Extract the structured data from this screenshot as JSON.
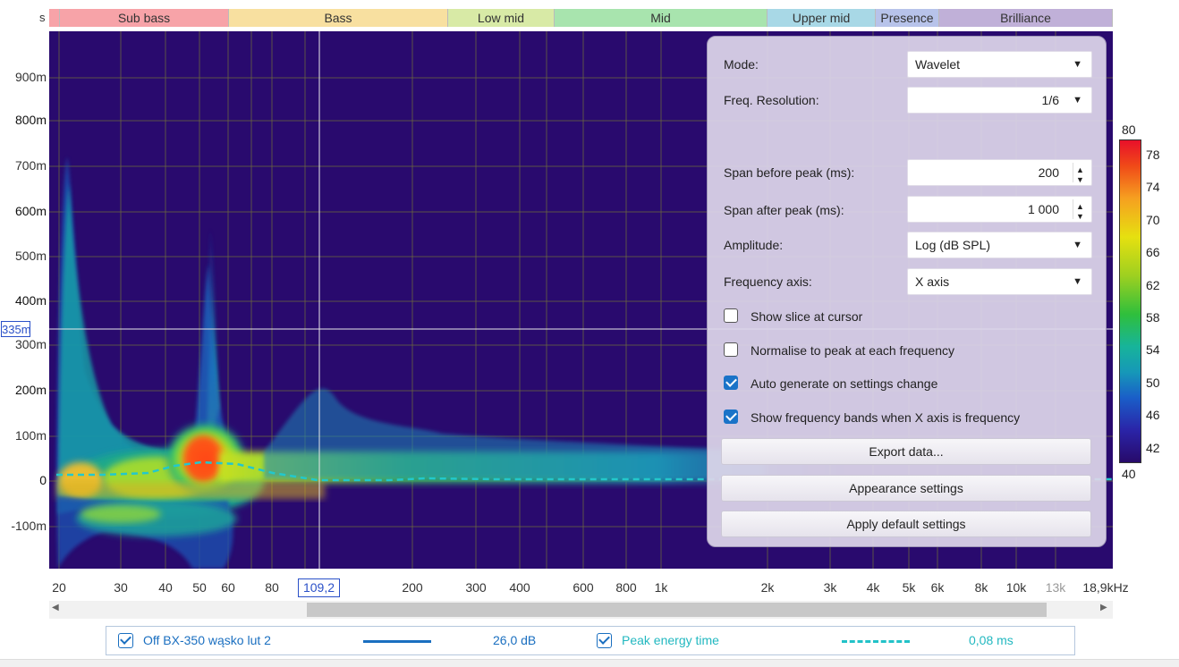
{
  "axis_unit_label": "s",
  "freq_bands": [
    {
      "label": "Sub bass",
      "color": "#f7a3a8"
    },
    {
      "label": "Bass",
      "color": "#f8e0a0"
    },
    {
      "label": "Low mid",
      "color": "#d8eaa6"
    },
    {
      "label": "Mid",
      "color": "#a8e4ae"
    },
    {
      "label": "Upper mid",
      "color": "#a8d8e6"
    },
    {
      "label": "Presence",
      "color": "#b7c3ea"
    },
    {
      "label": "Brilliance",
      "color": "#c0b0d8"
    }
  ],
  "y_labels": [
    "900m",
    "800m",
    "700m",
    "600m",
    "500m",
    "400m",
    "300m",
    "200m",
    "100m",
    "0",
    "-100m"
  ],
  "y_bold": [
    "800m",
    "600m",
    "400m",
    "200m",
    "0"
  ],
  "x_labels": [
    "20",
    "30",
    "40",
    "50",
    "60",
    "80",
    "200",
    "300",
    "400",
    "600",
    "800",
    "1k",
    "2k",
    "3k",
    "4k",
    "5k",
    "6k",
    "8k",
    "10k",
    "13k",
    "18,9kHz"
  ],
  "cursor": {
    "x_readout": "109,2",
    "y_readout": "335m"
  },
  "colorbar": {
    "max": "80",
    "min": "40",
    "ticks": [
      "78",
      "74",
      "70",
      "66",
      "62",
      "58",
      "54",
      "50",
      "46",
      "42"
    ]
  },
  "panel": {
    "mode_label": "Mode:",
    "mode_value": "Wavelet",
    "freq_res_label": "Freq. Resolution:",
    "freq_res_value": "1/6",
    "span_before_label": "Span before peak (ms):",
    "span_before_value": "200",
    "span_after_label": "Span after peak (ms):",
    "span_after_value": "1 000",
    "amplitude_label": "Amplitude:",
    "amplitude_value": "Log (dB SPL)",
    "freq_axis_label": "Frequency axis:",
    "freq_axis_value": "X axis",
    "checkboxes": [
      {
        "label": "Show slice at cursor",
        "checked": false
      },
      {
        "label": "Normalise to peak at each frequency",
        "checked": false
      },
      {
        "label": "Auto generate on settings change",
        "checked": true
      },
      {
        "label": "Show frequency bands when X axis is frequency",
        "checked": true
      }
    ],
    "export_label": "Export data...",
    "appearance_label": "Appearance settings",
    "defaults_label": "Apply default settings"
  },
  "legend": {
    "series1_name": "Off BX-350 wąsko lut 2",
    "series1_value": "26,0 dB",
    "series1_color": "#1a6fc0",
    "series2_name": "Peak energy time",
    "series2_value": "0,08 ms",
    "series2_color": "#22c2c8"
  }
}
